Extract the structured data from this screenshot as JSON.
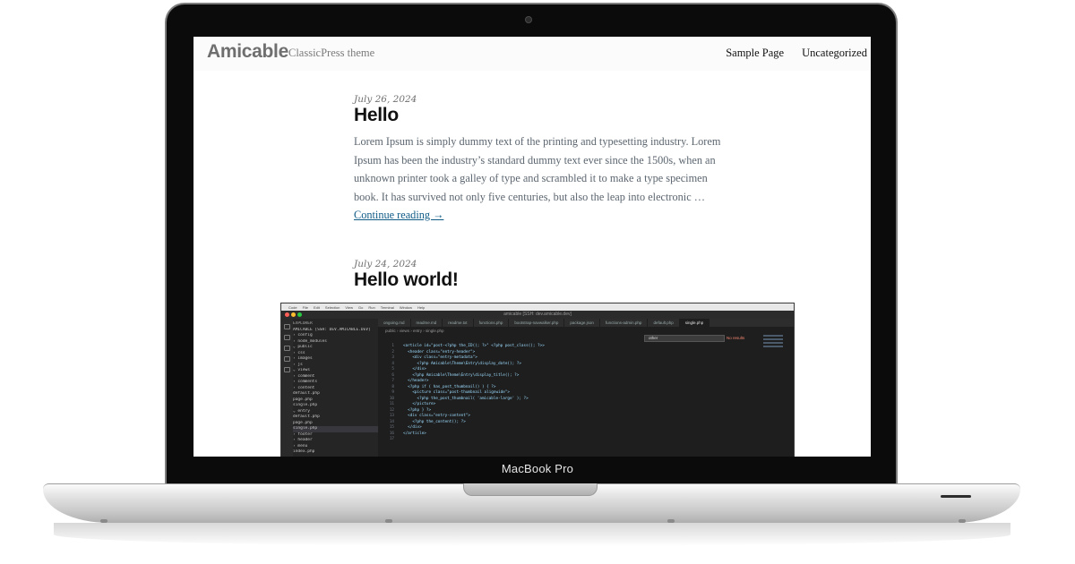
{
  "device": {
    "label": "MacBook Pro"
  },
  "site": {
    "title": "Amicable",
    "tagline": "ClassicPress theme",
    "nav": [
      "Sample Page",
      "Uncategorized"
    ]
  },
  "posts": [
    {
      "date": "July 26, 2024",
      "title": "Hello",
      "excerpt": "Lorem Ipsum is simply dummy text of the printing and typesetting industry. Lorem Ipsum has been the industry’s standard dummy text ever since the 1500s, when an unknown printer took a galley of type and scrambled it to make a type specimen book. It has survived not only five centuries, but also the leap into electronic …",
      "more_link": "Continue reading →"
    },
    {
      "date": "July 24, 2024",
      "title": "Hello world!"
    }
  ],
  "editor": {
    "window_title": "amicable [SSH: dev.amicable.dev]",
    "menubar": [
      "Code",
      "File",
      "Edit",
      "Selection",
      "View",
      "Go",
      "Run",
      "Terminal",
      "Window",
      "Help"
    ],
    "tabs": [
      "ongoing.md",
      "readme.md",
      "readme.txt",
      "functions.php",
      "bootstrap-navwalker.php",
      "package.json",
      "functions-admin.php",
      "default.php",
      "single.php"
    ],
    "active_tab": "single.php",
    "breadcrumb": "public › views › entry › single.php",
    "find_value": "other",
    "find_result": "No results",
    "explorer_header": "EXPLORER",
    "explorer_items": [
      "AMICABLE [SSH: DEV.AMICABLE.DEV]",
      "› config",
      "› node_modules",
      "⌄ public",
      "  › css",
      "  › images",
      "  › js",
      "⌄ views",
      "  › comment",
      "  › comments",
      "  › content",
      "    default.php",
      "    page.php",
      "    single.php",
      "  ⌄ entry",
      "    default.php",
      "    page.php",
      "    single.php",
      "  › footer",
      "  › header",
      "  › menu",
      "  index.php"
    ],
    "active_explorer_item": 17,
    "code_lines": [
      "<article id=\"post-<?php the_ID(); ?>\" <?php post_class(); ?>>",
      "  <header class=\"entry-header\">",
      "    <div class=\"entry-metadata\">",
      "      <?php Amicable\\Theme\\Entry\\display_date(); ?>",
      "    </div>",
      "    <?php Amicable\\Theme\\Entry\\display_title(); ?>",
      "  </header>",
      "  <?php if ( has_post_thumbnail() ) { ?>",
      "    <picture class=\"post-thumbnail alignwide\">",
      "      <?php the_post_thumbnail( 'amicable-large' ); ?>",
      "    </picture>",
      "  <?php } ?>",
      "  <div class=\"entry-content\">",
      "    <?php the_content(); ?>",
      "  </div>",
      "</article>",
      ""
    ]
  }
}
